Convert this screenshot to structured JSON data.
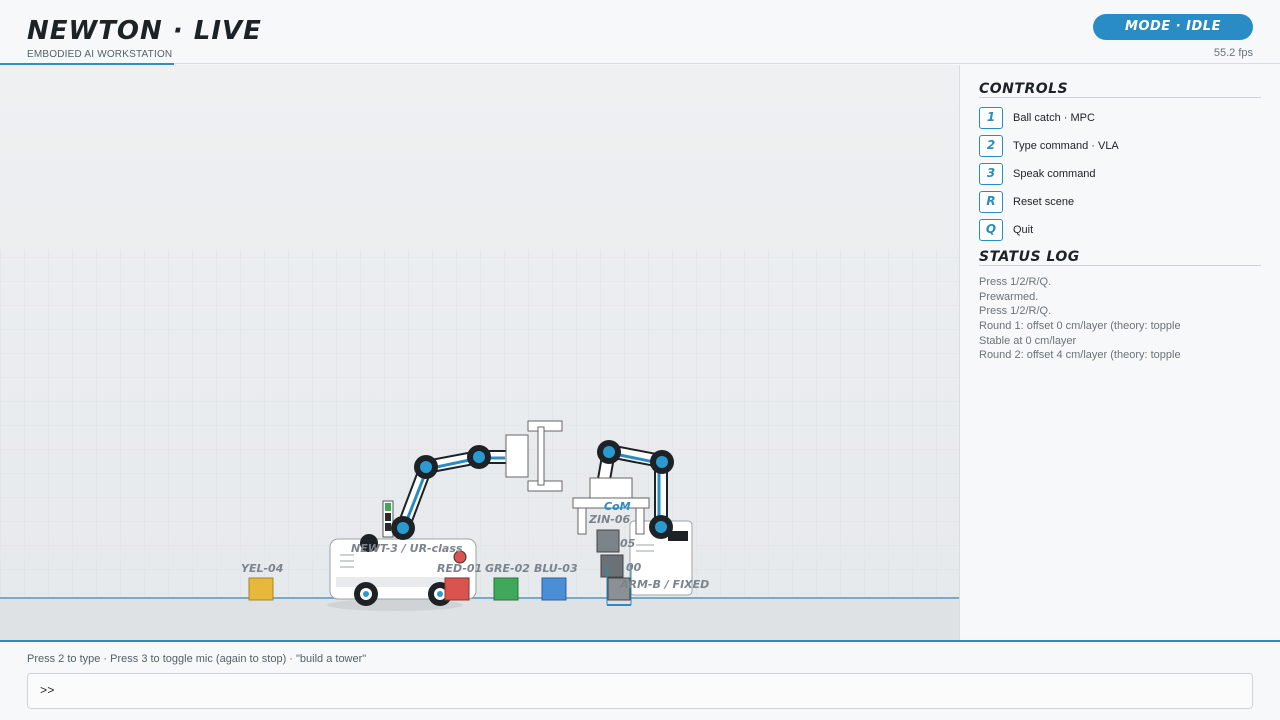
{
  "header": {
    "title": "NEWTON · LIVE",
    "subtitle": "EMBODIED AI WORKSTATION",
    "mode_badge": "MODE · IDLE",
    "fps": "55.2 fps"
  },
  "scene": {
    "robot_a_label": "NEWT-3 / UR-class",
    "robot_b_label": "ARM-B / FIXED",
    "com_label": "CoM",
    "zin_label": "ZIN-06",
    "box_label_partial": "05",
    "box_label_partial2": "00",
    "blocks": [
      {
        "label": "YEL-04",
        "color": "#e8b83a"
      },
      {
        "label": "RED-01",
        "color": "#d9534f"
      },
      {
        "label": "GRE-02",
        "color": "#3fa85a"
      },
      {
        "label": "BLU-03",
        "color": "#4a8fd6"
      }
    ],
    "colors": {
      "accent": "#2a8cc4",
      "joint": "#1d2226",
      "joint_center": "#2a9bd0"
    }
  },
  "controls": {
    "heading": "CONTROLS",
    "items": [
      {
        "key": "1",
        "label": "Ball catch · MPC"
      },
      {
        "key": "2",
        "label": "Type command · VLA"
      },
      {
        "key": "3",
        "label": "Speak command"
      },
      {
        "key": "R",
        "label": "Reset scene"
      },
      {
        "key": "Q",
        "label": "Quit"
      }
    ]
  },
  "status_log": {
    "heading": "STATUS LOG",
    "lines": [
      "Press 1/2/R/Q.",
      "Prewarmed.",
      "Press 1/2/R/Q.",
      "Round 1: offset 0 cm/layer (theory: topple",
      "Stable at 0 cm/layer",
      "Round 2: offset 4 cm/layer (theory: topple"
    ]
  },
  "footer": {
    "hint": "Press 2 to type  ·  Press 3 to toggle mic (again to stop)  ·  \"build a tower\"",
    "prompt": ">>",
    "input_value": "",
    "input_placeholder": ""
  }
}
